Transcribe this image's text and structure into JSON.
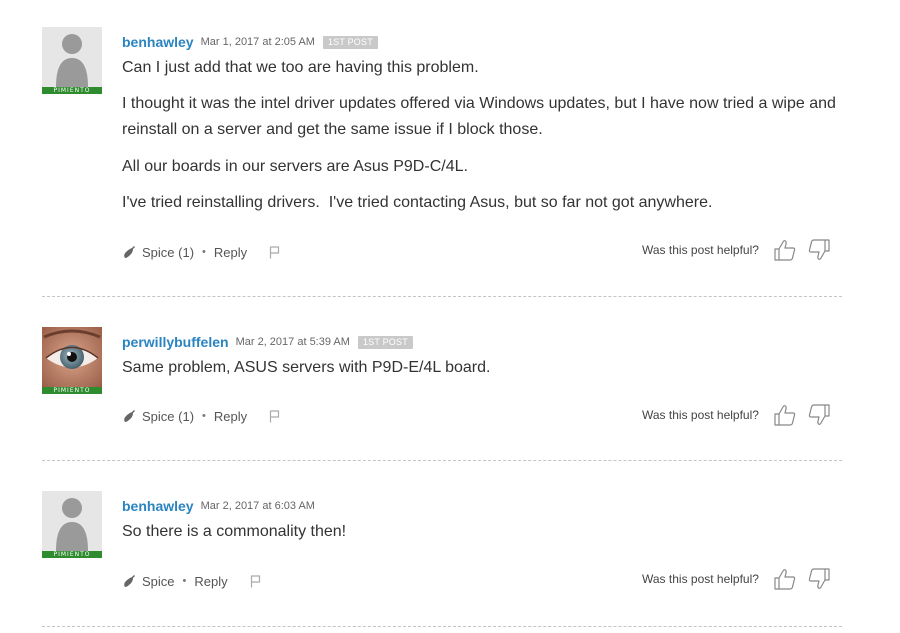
{
  "posts": [
    {
      "username": "benhawley",
      "timestamp": "Mar 1, 2017 at 2:05 AM",
      "badge": "1ST POST",
      "rank": "PIMIENTO",
      "avatar": "default-person-avatar",
      "paragraphs": [
        "Can I just add that we too are having this problem.",
        "I thought it was the intel driver updates offered via Windows updates, but I have now tried a wipe and reinstall on a server and get the same issue if I block those.",
        "All our boards in our servers are Asus P9D-C/4L.",
        "I've tried reinstalling drivers.  I've tried contacting Asus, but so far not got anywhere."
      ],
      "spice_label": "Spice (1)",
      "reply_label": "Reply",
      "helpful_label": "Was this post helpful?"
    },
    {
      "username": "perwillybuffelen",
      "timestamp": "Mar 2, 2017 at 5:39 AM",
      "badge": "1ST POST",
      "rank": "PIMIENTO",
      "avatar": "eye-photo-avatar",
      "paragraphs": [
        "Same problem, ASUS servers with P9D-E/4L board."
      ],
      "spice_label": "Spice (1)",
      "reply_label": "Reply",
      "helpful_label": "Was this post helpful?"
    },
    {
      "username": "benhawley",
      "timestamp": "Mar 2, 2017 at 6:03 AM",
      "badge": "",
      "rank": "PIMIENTO",
      "avatar": "default-person-avatar",
      "paragraphs": [
        "So there is a commonality then!"
      ],
      "spice_label": "Spice",
      "reply_label": "Reply",
      "helpful_label": "Was this post helpful?"
    }
  ],
  "colors": {
    "username": "#2a84c1",
    "rank_bg": "#2e8b2e",
    "badge_bg": "#c9c9c9",
    "body_text": "#333333",
    "meta_text": "#666666"
  },
  "icons": {
    "spice": "pepper-icon",
    "flag": "flag-icon",
    "thumb_up": "thumbs-up-icon",
    "thumb_down": "thumbs-down-icon"
  }
}
